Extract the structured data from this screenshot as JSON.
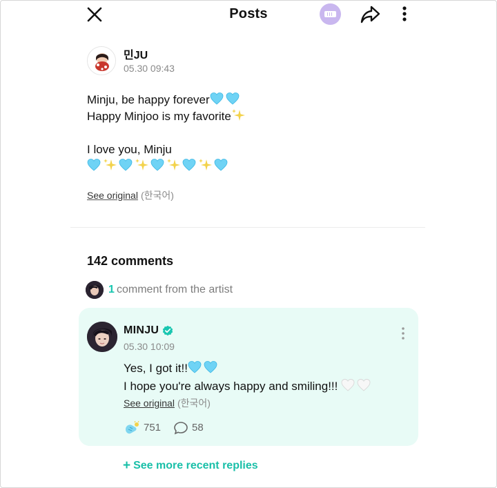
{
  "header": {
    "title": "Posts",
    "icons": [
      "close-icon",
      "dm-icon",
      "share-icon",
      "more-vertical-icon"
    ]
  },
  "post": {
    "author": "민JU",
    "timestamp": "05.30 09:43",
    "lines": [
      "Minju, be happy forever",
      "Happy Minjoo is my favorite",
      "I love you, Minju"
    ],
    "see_original": "See original",
    "language": "(한국어)"
  },
  "comments": {
    "count_label": "142 comments",
    "artist_count": "1",
    "artist_label": "comment from the artist"
  },
  "artist_comment": {
    "author": "MINJU",
    "timestamp": "05.30 10:09",
    "lines": [
      "Yes, I got it!!",
      "I hope you're always happy and smiling!!!"
    ],
    "see_original": "See original",
    "language": "(한국어)",
    "likes": "751",
    "replies": "58"
  },
  "see_more": {
    "label": "See more recent replies"
  },
  "colors": {
    "accent": "#19c6b0",
    "card_bg": "#e8fbf6",
    "heart": "#6fd3f5",
    "sparkle": "#f3d24a",
    "dm_button": "#c9b7ef"
  }
}
